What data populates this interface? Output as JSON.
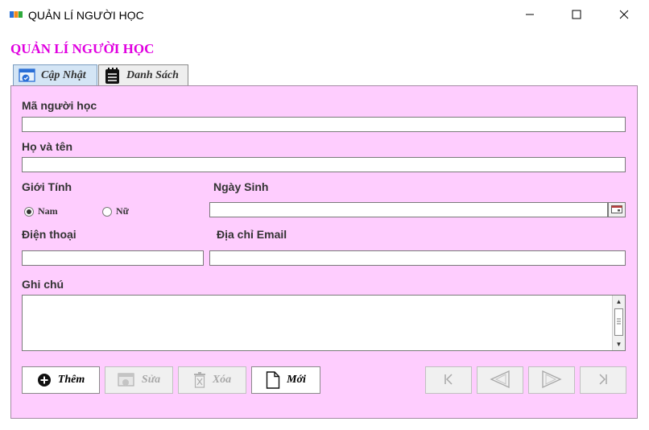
{
  "window": {
    "title": "QUẢN LÍ NGƯỜI HỌC",
    "minimize_icon": "minimize-icon",
    "maximize_icon": "maximize-icon",
    "close_icon": "close-icon"
  },
  "form": {
    "heading": "QUẢN LÍ NGƯỜI HỌC",
    "heading_color": "#e000e0",
    "panel_color": "#fecdfe"
  },
  "tabs": [
    {
      "label": "Cập Nhật",
      "icon": "edit-form-icon",
      "active": true
    },
    {
      "label": "Danh Sách",
      "icon": "notepad-list-icon",
      "active": false
    }
  ],
  "fields": {
    "student_id": {
      "label": "Mã người học",
      "value": ""
    },
    "full_name": {
      "label": "Họ và tên",
      "value": ""
    },
    "gender": {
      "label": "Giới Tính",
      "options": [
        "Nam",
        "Nữ"
      ],
      "selected": "Nam"
    },
    "birth_date": {
      "label": "Ngày Sinh",
      "value": "",
      "icon": "calendar-icon"
    },
    "phone": {
      "label": "Điện thoại",
      "value": ""
    },
    "email": {
      "label": "Địa chỉ Email",
      "value": ""
    },
    "notes": {
      "label": "Ghi chú",
      "value": ""
    }
  },
  "buttons": {
    "add": {
      "label": "Thêm",
      "icon": "plus-circle-icon",
      "enabled": true
    },
    "edit": {
      "label": "Sửa",
      "icon": "edit-icon",
      "enabled": false
    },
    "delete": {
      "label": "Xóa",
      "icon": "trash-icon",
      "enabled": false
    },
    "new": {
      "label": "Mới",
      "icon": "new-document-icon",
      "enabled": true
    }
  },
  "navigation": {
    "first": {
      "icon": "first-record-icon",
      "enabled": false
    },
    "prev": {
      "icon": "previous-record-icon",
      "enabled": false
    },
    "next": {
      "icon": "next-record-icon",
      "enabled": false
    },
    "last": {
      "icon": "last-record-icon",
      "enabled": false
    }
  }
}
